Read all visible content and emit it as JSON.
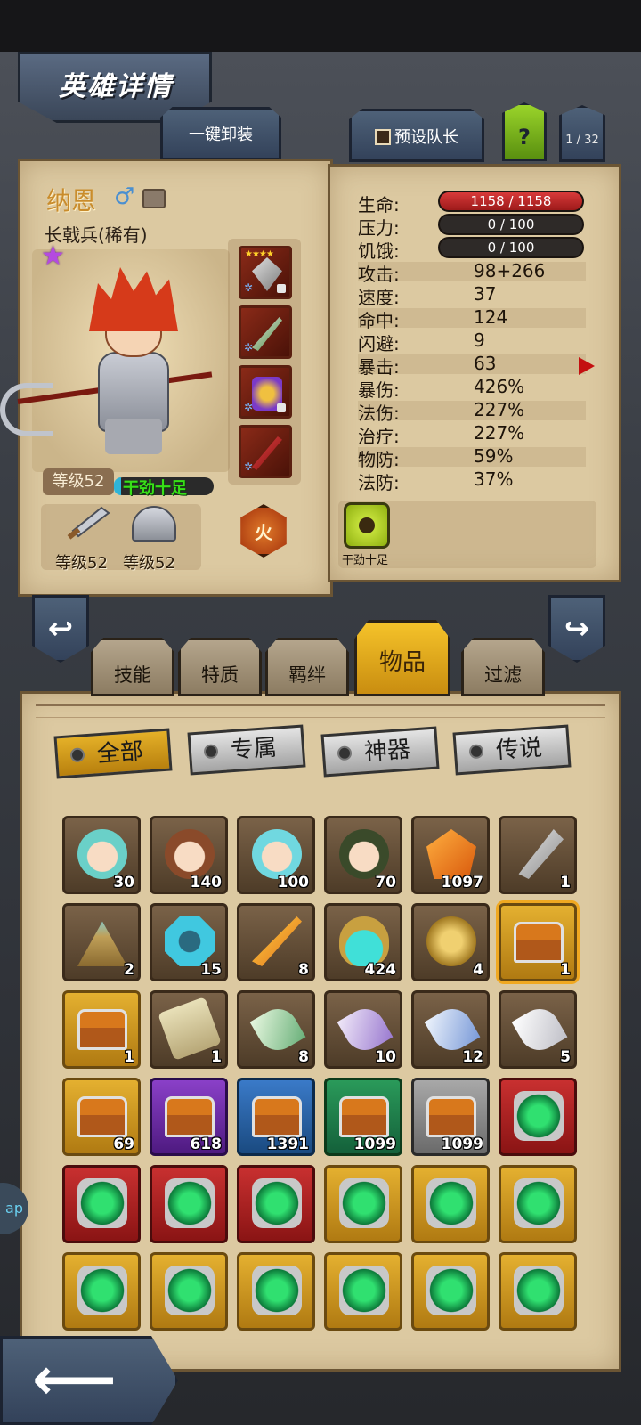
{
  "header": {
    "title": "英雄详情",
    "unequip_all": "一键卸装",
    "preset_leader": "预设队长",
    "help": "?",
    "page": "1 / 32"
  },
  "hero": {
    "name": "纳恩",
    "gender_icon": "male-symbol-icon",
    "class": "长戟兵(稀有)",
    "level": "等级52",
    "status": "干劲十足",
    "weapon_level": "等级52",
    "armor_level": "等级52",
    "element": "火",
    "equip_stars": "★★★★"
  },
  "stats": {
    "hp": {
      "label": "生命:",
      "value": "1158 / 1158"
    },
    "stress": {
      "label": "压力:",
      "value": "0 / 100"
    },
    "hunger": {
      "label": "饥饿:",
      "value": "0 / 100"
    },
    "rows": [
      {
        "label": "攻击:",
        "value": "98+266"
      },
      {
        "label": "速度:",
        "value": "37"
      },
      {
        "label": "命中:",
        "value": "124"
      },
      {
        "label": "闪避:",
        "value": "9"
      },
      {
        "label": "暴击:",
        "value": "63"
      },
      {
        "label": "暴伤:",
        "value": "426%"
      },
      {
        "label": "法伤:",
        "value": "227%"
      },
      {
        "label": "治疗:",
        "value": "227%"
      },
      {
        "label": "物防:",
        "value": "59%"
      },
      {
        "label": "法防:",
        "value": "37%"
      }
    ],
    "trait": "干劲十足"
  },
  "tabs": [
    "技能",
    "特质",
    "羁绊",
    "物品",
    "过滤"
  ],
  "filters": [
    "全部",
    "专属",
    "神器",
    "传说"
  ],
  "inventory": {
    "counts": [
      "30",
      "140",
      "100",
      "70",
      "1097",
      "1",
      "2",
      "15",
      "8",
      "424",
      "4",
      "1",
      "1",
      "1",
      "8",
      "10",
      "12",
      "5",
      "69",
      "618",
      "1391",
      "1099",
      "1099"
    ]
  },
  "side_bubble": "ap",
  "colors": {
    "accent": "#f5c32a",
    "parchment": "#dcc9a1",
    "hp_bar": "#d83a3a"
  }
}
